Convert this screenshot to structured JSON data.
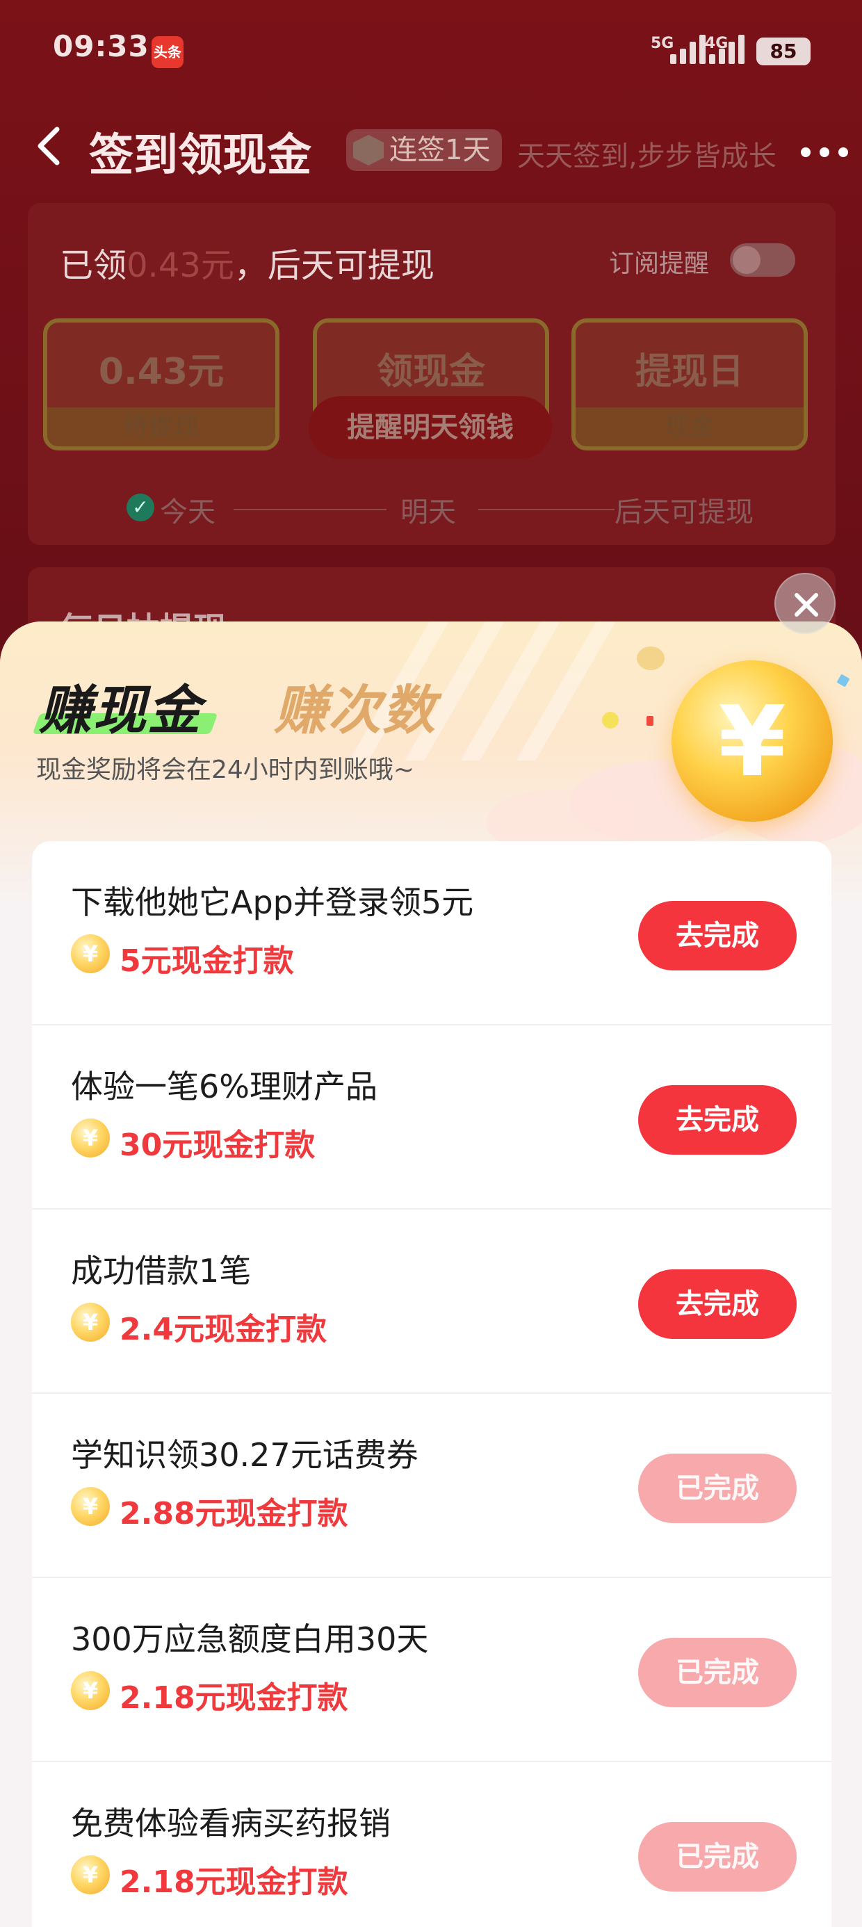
{
  "status_bar": {
    "time": "09:33",
    "app_badge": "头条",
    "signal_1": "5G",
    "signal_2": "4G",
    "battery": "85"
  },
  "nav": {
    "title": "签到领现金",
    "streak": "连签1天",
    "slogan": "天天签到,步步皆成长"
  },
  "checkin_card": {
    "title_prefix": "已领",
    "title_amount": "0.43元",
    "title_suffix": "，后天可提现",
    "subscribe_label": "订阅提醒",
    "box1_value": "0.43元",
    "box1_label": "待提现",
    "box2_value": "领现金",
    "box2_button": "提醒明天领钱",
    "box3_value": "提现日",
    "box3_label": "现金",
    "timeline": [
      "今天",
      "明天",
      "后天可提现"
    ]
  },
  "daily_card": {
    "title": "每日抽提现"
  },
  "sheet": {
    "tab_active": "赚现金",
    "tab_inactive": "赚次数",
    "subtitle": "现金奖励将会在24小时内到账哦~",
    "coin_symbol": "¥",
    "tasks": [
      {
        "title": "下载他她它App并登录领5元",
        "reward": "5元现金打款",
        "button": "去完成",
        "state": "active"
      },
      {
        "title": "体验一笔6%理财产品",
        "reward": "30元现金打款",
        "button": "去完成",
        "state": "active"
      },
      {
        "title": "成功借款1笔",
        "reward": "2.4元现金打款",
        "button": "去完成",
        "state": "active"
      },
      {
        "title": "学知识领30.27元话费券",
        "reward": "2.88元现金打款",
        "button": "已完成",
        "state": "done"
      },
      {
        "title": "300万应急额度白用30天",
        "reward": "2.18元现金打款",
        "button": "已完成",
        "state": "done"
      },
      {
        "title": "免费体验看病买药报销",
        "reward": "2.18元现金打款",
        "button": "已完成",
        "state": "done"
      }
    ]
  },
  "colors": {
    "accent": "#f5353d",
    "done_button": "#f8a9ac",
    "reward_text": "#f0393c"
  }
}
